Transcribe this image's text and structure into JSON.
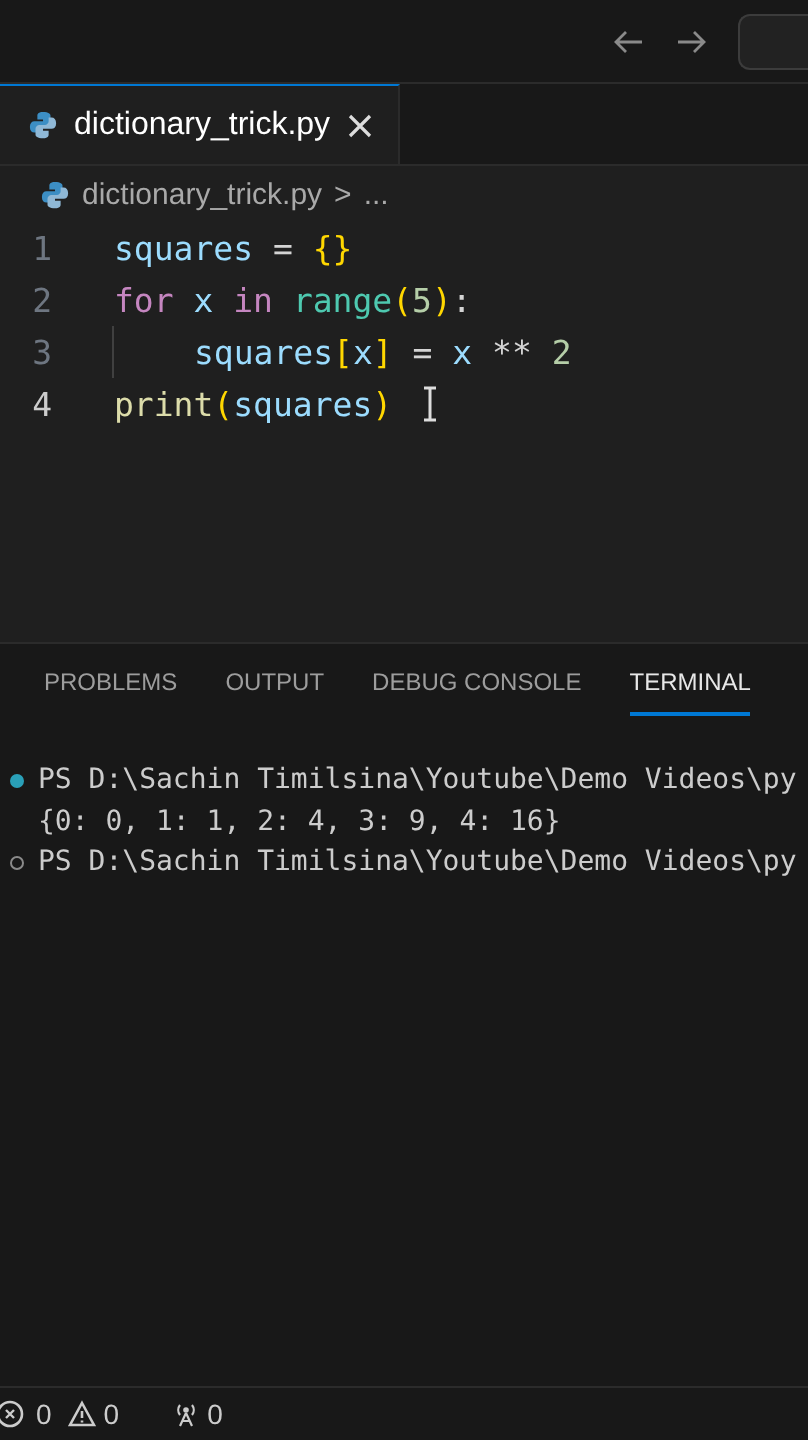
{
  "tabs": [
    {
      "label": "dictionary_trick.py",
      "selected": true
    }
  ],
  "breadcrumb": {
    "file": "dictionary_trick.py",
    "separator": ">",
    "rest": "..."
  },
  "code": [
    {
      "number": "1",
      "current": false,
      "indent": false,
      "tokens": [
        {
          "kind": "var",
          "text": "squares"
        },
        {
          "kind": "op",
          "text": " = "
        },
        {
          "kind": "brace",
          "text": "{}"
        }
      ]
    },
    {
      "number": "2",
      "current": false,
      "indent": false,
      "tokens": [
        {
          "kind": "keyword",
          "text": "for"
        },
        {
          "kind": "var",
          "text": " x "
        },
        {
          "kind": "keyword",
          "text": "in "
        },
        {
          "kind": "builtin",
          "text": "range"
        },
        {
          "kind": "brace",
          "text": "("
        },
        {
          "kind": "number",
          "text": "5"
        },
        {
          "kind": "brace",
          "text": ")"
        },
        {
          "kind": "op",
          "text": ":"
        }
      ]
    },
    {
      "number": "3",
      "current": false,
      "indent": true,
      "tokens": [
        {
          "kind": "var",
          "text": "squares"
        },
        {
          "kind": "brace",
          "text": "["
        },
        {
          "kind": "var",
          "text": "x"
        },
        {
          "kind": "brace",
          "text": "]"
        },
        {
          "kind": "op",
          "text": " = "
        },
        {
          "kind": "var",
          "text": "x"
        },
        {
          "kind": "op",
          "text": " ** "
        },
        {
          "kind": "number",
          "text": "2"
        }
      ]
    },
    {
      "number": "4",
      "current": true,
      "indent": false,
      "tokens": [
        {
          "kind": "function",
          "text": "print"
        },
        {
          "kind": "brace",
          "text": "("
        },
        {
          "kind": "var",
          "text": "squares"
        },
        {
          "kind": "brace",
          "text": ")"
        }
      ]
    }
  ],
  "panel_tabs": [
    {
      "label": "PROBLEMS",
      "selected": false
    },
    {
      "label": "OUTPUT",
      "selected": false
    },
    {
      "label": "DEBUG CONSOLE",
      "selected": false
    },
    {
      "label": "TERMINAL",
      "selected": true
    }
  ],
  "terminal": [
    {
      "kind": "prompt",
      "succeeded": true,
      "text": "PS D:\\Sachin Timilsina\\Youtube\\Demo Videos\\py"
    },
    {
      "kind": "output",
      "text": "{0: 0, 1: 1, 2: 4, 3: 9, 4: 16}"
    },
    {
      "kind": "prompt",
      "succeeded": false,
      "text": "PS D:\\Sachin Timilsina\\Youtube\\Demo Videos\\py"
    }
  ],
  "status_bar": {
    "errors": "0",
    "warnings": "0",
    "ports": "0"
  }
}
